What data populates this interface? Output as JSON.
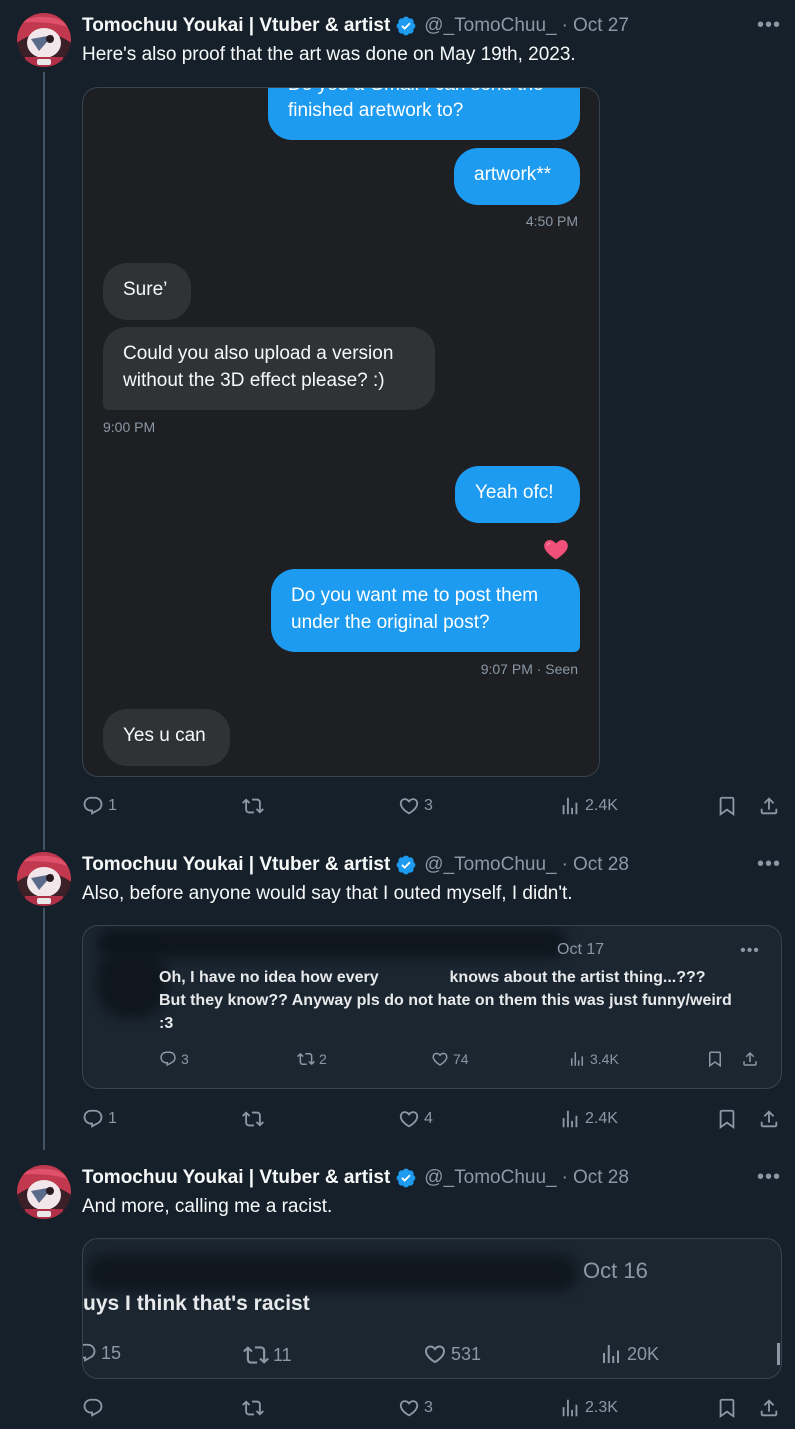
{
  "tweets": [
    {
      "name": "Tomochuu Youkai | Vtuber & artist",
      "handle": "@_TomoChuu_",
      "sep": "·",
      "date": "Oct 27",
      "text": "Here's also proof that the art was done on May 19th, 2023.",
      "dm": {
        "msg1": [
          "Do you a Gmail I can send the",
          "finished aretwork to?"
        ],
        "msg2": "artwork**",
        "time1": "4:50 PM",
        "msg3": "Sure’",
        "msg4": [
          "Could you also upload a version",
          "without the 3D effect please? :)"
        ],
        "time2": "9:00 PM",
        "msg5": "Yeah ofc!",
        "msg6": [
          "Do you want me to post them",
          "under the original post?"
        ],
        "time3": "9:07 PM · Seen",
        "msg7": "Yes u can"
      },
      "stats": {
        "replies": "1",
        "reposts": "",
        "likes": "3",
        "views": "2.4K"
      }
    },
    {
      "name": "Tomochuu Youkai | Vtuber & artist",
      "handle": "@_TomoChuu_",
      "sep": "·",
      "date": "Oct 28",
      "text": "Also, before anyone would say that I outed myself, I didn't.",
      "quote": {
        "date": "Oct 17",
        "line1a": "Oh, I have no idea how every",
        "line1b": "knows about the artist thing...???",
        "line2": "But they know?? Anyway pls do not hate on them this was just funny/weird",
        "line3": ":3",
        "stats": {
          "replies": "3",
          "reposts": "2",
          "likes": "74",
          "views": "3.4K"
        }
      },
      "stats": {
        "replies": "1",
        "reposts": "",
        "likes": "4",
        "views": "2.4K"
      }
    },
    {
      "name": "Tomochuu Youkai | Vtuber & artist",
      "handle": "@_TomoChuu_",
      "sep": "·",
      "date": "Oct 28",
      "text": "And more, calling me a racist.",
      "quote": {
        "date": "Oct 16",
        "line1": "uys I think that's racist",
        "stats": {
          "replies": "15",
          "reposts": "11",
          "likes": "531",
          "views": "20K"
        }
      },
      "stats": {
        "replies": "",
        "reposts": "",
        "likes": "3",
        "views": "2.3K"
      }
    }
  ],
  "icons": {
    "reply": "reply-icon",
    "repost": "repost-icon",
    "like": "heart-icon",
    "views": "views-icon",
    "bookmark": "bookmark-icon",
    "share": "share-icon",
    "verified": "verified-badge-icon",
    "more": "more-icon"
  },
  "colors": {
    "background": "#15202b",
    "accent": "#1d9bf0",
    "muted": "#8b98a5",
    "dm_background": "#1d1f23",
    "incoming_bubble": "#2f3336"
  }
}
